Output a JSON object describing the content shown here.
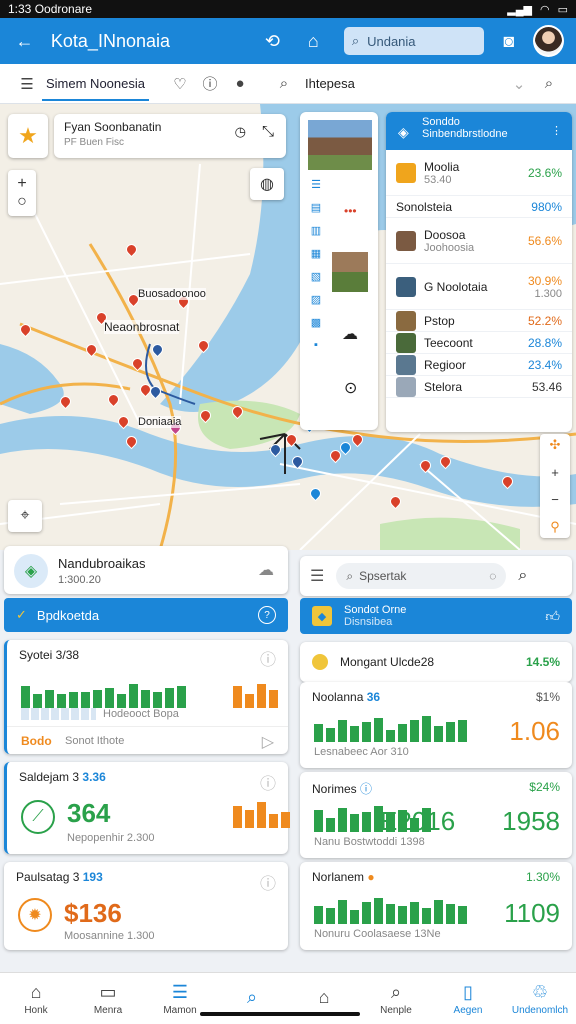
{
  "status": {
    "time": "1:33",
    "carrier": "Oodronare",
    "battery": "100"
  },
  "appbar": {
    "title": "Kota_INnonaia",
    "search_placeholder": "Undania"
  },
  "subbar": {
    "tab_label": "Simem Noonesia",
    "search_text": "Ihtepesa"
  },
  "map_overlay": {
    "place_title": "Fyan Soonbanatin",
    "place_sub": "PF Buen Fisc",
    "label_a": "Neaonbrosnat",
    "label_b": "Buosadoonoo",
    "label_c": "Doniaaia",
    "panel_header_title": "Sonddo",
    "panel_header_sub": "Sinbendbrstlodne",
    "panel_rows": [
      {
        "name": "Moolia",
        "pct": "23.6%",
        "sub": "53.40"
      },
      {
        "name": "Sonolsteia",
        "pct": "980%",
        "sub": ""
      },
      {
        "name": "Doosoa",
        "pct": "56.6%",
        "sub": "Joohoosia"
      },
      {
        "name": "G Noolotaia",
        "pct": "30.9%",
        "sub": "1.300"
      },
      {
        "name": "Pstop",
        "pct": "52.2%",
        "sub": ""
      },
      {
        "name": "Teecoont",
        "pct": "28.8%",
        "sub": ""
      },
      {
        "name": "Regioor",
        "pct": "23.4%",
        "sub": ""
      },
      {
        "name": "Stelora",
        "pct": "53.46",
        "sub": ""
      }
    ]
  },
  "left": {
    "header_title": "Nandubroaikas",
    "header_sub": "1:300.20",
    "blue_bar_label": "Bpdkoetda",
    "cards": [
      {
        "title": "Syotei 3/38",
        "caption": "Hodeooct Bopa",
        "footer": "Bodo",
        "footer2": "Sonot Ithote"
      },
      {
        "title": "Saldejam 3",
        "title_num": "3.36",
        "value": "364",
        "caption": "Nepopenhir 2.300"
      },
      {
        "title": "Paulsatag 3",
        "title_num": "193",
        "value": "$136",
        "caption": "Moosannine 1.300"
      }
    ]
  },
  "right": {
    "search_placeholder": "Spsertak",
    "blue_title": "Sondot Orne",
    "blue_sub": "Disnsibea",
    "cards": [
      {
        "title": "Mongant Ulcde28",
        "pct": "14.5%"
      },
      {
        "title": "Noolanna",
        "title_num": "36",
        "pct": "$1%",
        "value": "1.06",
        "caption": "Lesnabeec Aor 310"
      },
      {
        "title": "Norimes",
        "pct": "$24%",
        "value": "E2016",
        "value2": "1958",
        "caption": "Nanu Bostwtoddi 1398"
      },
      {
        "title": "Norlanem",
        "pct": "1.30%",
        "value": "1109",
        "caption": "Nonuru Coolasaese 13Ne"
      }
    ]
  },
  "navbar": [
    {
      "label": "Honk",
      "icon": "home-icon"
    },
    {
      "label": "Menra",
      "icon": "bookmark-icon"
    },
    {
      "label": "Mamon",
      "icon": "list-icon"
    },
    {
      "label": "",
      "icon": "search-icon"
    },
    {
      "label": "",
      "icon": "home-outline-icon"
    },
    {
      "label": "Nenple",
      "icon": "search-icon"
    },
    {
      "label": "Aegen",
      "icon": "document-icon"
    },
    {
      "label": "Undenomlch",
      "icon": "recycle-icon"
    }
  ],
  "colors": {
    "primary": "#1b86d8",
    "green": "#2aa14a",
    "orange": "#ef8a1e",
    "water": "#9ccbe9",
    "pin": "#d9412a"
  }
}
